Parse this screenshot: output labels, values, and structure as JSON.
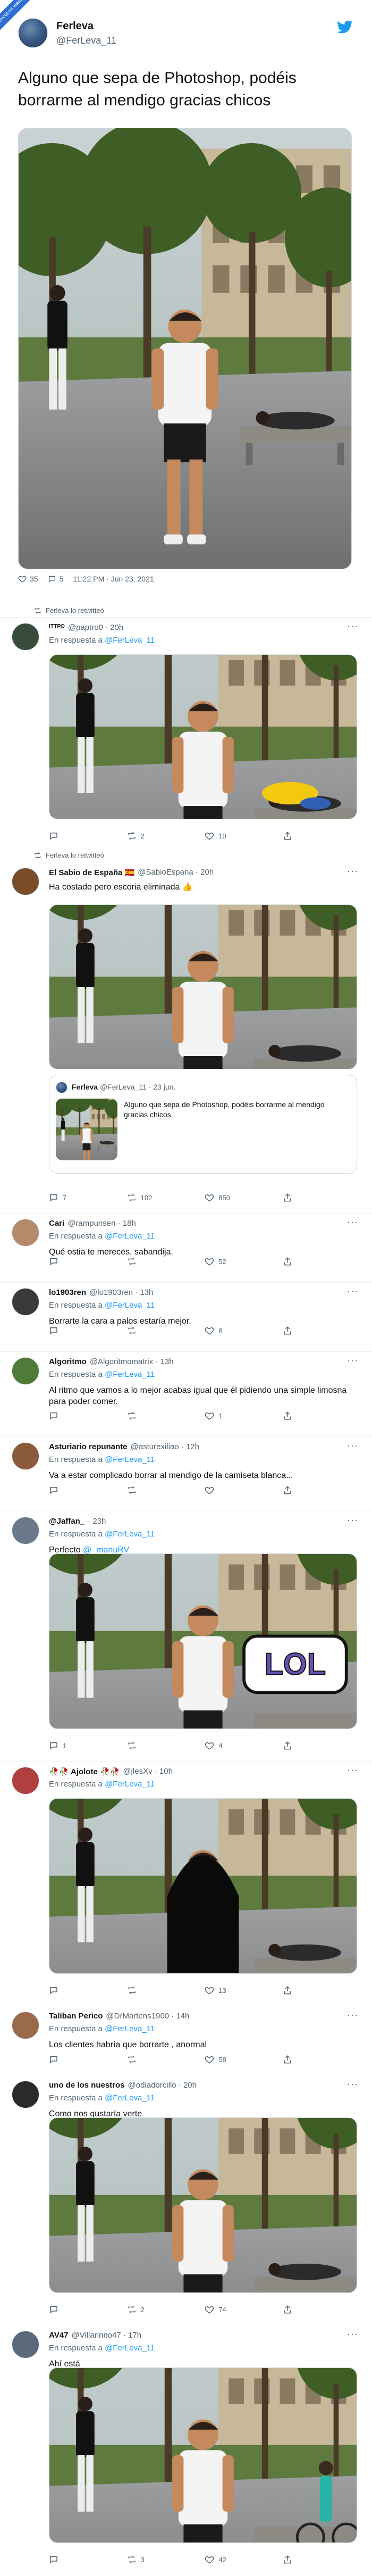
{
  "badge": "ARTICULOS VIRALES",
  "main_tweet": {
    "name": "Ferleva",
    "handle": "@FerLeva_11",
    "text": "Alguno que sepa de Photoshop, podéis borrarme al mendigo gracias chicos",
    "likes": "35",
    "retweets": "5",
    "timestamp": "11:22 PM · Jun 23, 2021"
  },
  "colors": {
    "accent": "#1d9bf0",
    "text": "#0f1419",
    "muted": "#536471"
  },
  "replies": [
    {
      "retweet_label": "Ferleva lo retwitteó",
      "name": "ᴵᵀᵀᴾᴼ",
      "meta": "@paptro0 · 20h",
      "reply_to_prefix": "En respuesta a",
      "reply_to": "@FerLeva_11",
      "text": "",
      "replies": "",
      "retweets": "2",
      "likes": "10"
    },
    {
      "retweet_label": "Ferleva lo retwitteó",
      "name": "El Sabio de España 🇪🇸",
      "meta": "@SabioEspana · 20h",
      "text": "Ha costado pero escoria eliminada 👍",
      "replies": "7",
      "retweets": "102",
      "likes": "850",
      "quote": {
        "name": "Ferleva",
        "meta": "@FerLeva_11 · 23 jun.",
        "text": "Alguno que sepa de Photoshop, podéis borrarme al mendigo gracias chicos"
      }
    },
    {
      "name": "Cari",
      "meta": "@rampunsen · 18h",
      "reply_to_prefix": "En respuesta a",
      "reply_to": "@FerLeva_11",
      "text": "Qué ostia te mereces, sabandija.",
      "replies": "",
      "retweets": "",
      "likes": "52"
    },
    {
      "name": "lo1903ren",
      "meta": "@lo1903ren · 13h",
      "reply_to_prefix": "En respuesta a",
      "reply_to": "@FerLeva_11",
      "text": "Borrarte la cara a palos estaría mejor.",
      "replies": "",
      "retweets": "",
      "likes": "8"
    },
    {
      "name": "Algoritmo",
      "meta": "@Algoritmomatrix · 13h",
      "reply_to_prefix": "En respuesta a",
      "reply_to": "@FerLeva_11",
      "text": "Al ritmo que vamos a lo mejor acabas igual que él pidiendo una simple limosna para poder comer.",
      "replies": "",
      "retweets": "",
      "likes": "1"
    },
    {
      "name": "Asturiario repunante",
      "meta": "@asturexiliao · 12h",
      "reply_to_prefix": "En respuesta a",
      "reply_to": "@FerLeva_11",
      "text": "Va a estar complicado borrar al mendigo de la camiseta blanca...",
      "replies": "",
      "retweets": "",
      "likes": ""
    },
    {
      "name": "@Jaffan_",
      "meta": "· 23h",
      "reply_to_prefix": "En respuesta a",
      "reply_to": "@FerLeva_11",
      "text_prefix": "Perfecto",
      "text_mention": "@_manuRV",
      "replies": "1",
      "retweets": "",
      "likes": "4",
      "sticker": "LOL"
    },
    {
      "name": "🥀🥀 Ajolote 🥀🥀",
      "meta": "@jlesXv · 10h",
      "reply_to_prefix": "En respuesta a",
      "reply_to": "@FerLeva_11",
      "text": "",
      "replies": "",
      "retweets": "",
      "likes": "13"
    },
    {
      "name": "Taliban Perico",
      "meta": "@DrMartens1900 · 14h",
      "reply_to_prefix": "En respuesta a",
      "reply_to": "@FerLeva_11",
      "text": "Los clientes habría que borrarte , anormal",
      "replies": "",
      "retweets": "",
      "likes": "58"
    },
    {
      "name": "uno de los nuestros",
      "meta": "@odiadorcillo · 20h",
      "reply_to_prefix": "En respuesta a",
      "reply_to": "@FerLeva_11",
      "text": "Como nos gustaría verte",
      "replies": "",
      "retweets": "2",
      "likes": "74"
    },
    {
      "name": "AV47",
      "meta": "@Villarinno47 · 17h",
      "reply_to_prefix": "En respuesta a",
      "reply_to": "@FerLeva_11",
      "text": "Ahí está",
      "replies": "",
      "retweets": "3",
      "likes": "42"
    }
  ]
}
